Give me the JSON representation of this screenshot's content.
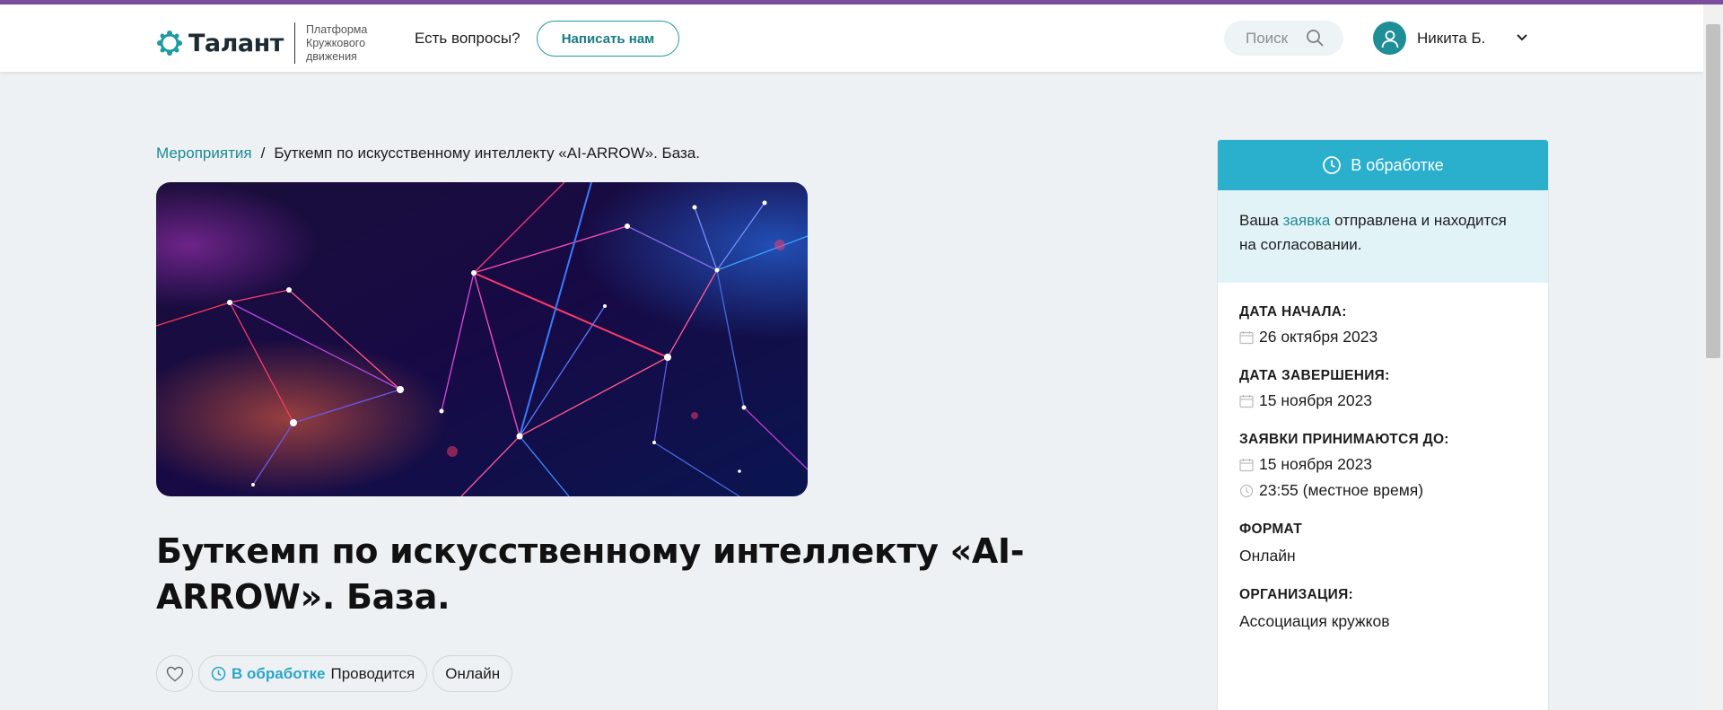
{
  "header": {
    "logo_name": "Талант",
    "logo_tagline": "Платформа Кружкового движения",
    "questions": "Есть вопросы?",
    "write_button": "Написать нам",
    "search_label": "Поиск",
    "user_name": "Никита Б."
  },
  "breadcrumb": {
    "parent": "Мероприятия",
    "separator": "/",
    "current": "Буткемп по искусственному интеллекту «AI-ARROW». База."
  },
  "event": {
    "title": "Буткемп по искусственному интеллекту «AI-ARROW». База.",
    "status": "В обработке",
    "state": "Проводится",
    "format_chip": "Онлайн"
  },
  "card": {
    "status": "В обработке",
    "note_prefix": "Ваша ",
    "note_link": "заявка",
    "note_suffix": " отправлена и находится на согласовании.",
    "start_label": "ДАТА НАЧАЛА:",
    "start_date": "26 октября 2023",
    "end_label": "ДАТА ЗАВЕРШЕНИЯ:",
    "end_date": "15 ноября 2023",
    "deadline_label": "ЗАЯВКИ ПРИНИМАЮТСЯ ДО:",
    "deadline_date": "15 ноября 2023",
    "deadline_time": "23:55 (местное время)",
    "format_label": "ФОРМАТ",
    "format_value": "Онлайн",
    "org_label": "ОРГАНИЗАЦИЯ:",
    "org_value": "Ассоциация кружков"
  },
  "colors": {
    "accent": "#1f9aa3",
    "status": "#2aafcc",
    "topline": "#7a4f9e"
  },
  "icons": [
    "logo-mark-icon",
    "search-icon",
    "user-icon",
    "chevron-down-icon",
    "clock-icon",
    "calendar-icon",
    "heart-icon"
  ]
}
